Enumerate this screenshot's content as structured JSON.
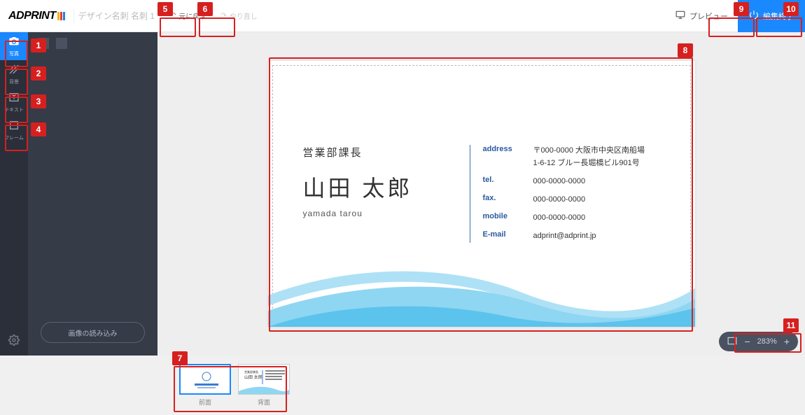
{
  "app": {
    "logo": "ADPRINT"
  },
  "doc": {
    "title": "デザイン名刺 名刺 1"
  },
  "history": {
    "undo": "元に戻す",
    "redo": "やり直し"
  },
  "header": {
    "preview": "プレビュー",
    "done": "編集終了"
  },
  "rail": {
    "items": [
      {
        "label": "写真",
        "icon": "camera"
      },
      {
        "label": "背景",
        "icon": "texture"
      },
      {
        "label": "テキスト",
        "icon": "text"
      },
      {
        "label": "フレーム",
        "icon": "frame"
      }
    ]
  },
  "side": {
    "load_btn": "画像の読み込み"
  },
  "card": {
    "role": "営業部課長",
    "name_jp": "山田 太郎",
    "name_en": "yamada tarou",
    "fields": [
      {
        "label": "address",
        "value": "〒000-0000 大阪市中央区南船場\n1-6-12 ブルー長堀橋ビル901号"
      },
      {
        "label": "tel.",
        "value": "000-0000-0000"
      },
      {
        "label": "fax.",
        "value": "000-0000-0000"
      },
      {
        "label": "mobile",
        "value": "000-0000-0000"
      },
      {
        "label": "E-mail",
        "value": "adprint@adprint.jp"
      }
    ]
  },
  "zoom": {
    "value": "283%"
  },
  "thumbs": [
    {
      "label": "前面"
    },
    {
      "label": "背面"
    }
  ],
  "callouts": {
    "c1": "1",
    "c2": "2",
    "c3": "3",
    "c4": "4",
    "c5": "5",
    "c6": "6",
    "c7": "7",
    "c8": "8",
    "c9": "9",
    "c10": "10",
    "c11": "11"
  }
}
